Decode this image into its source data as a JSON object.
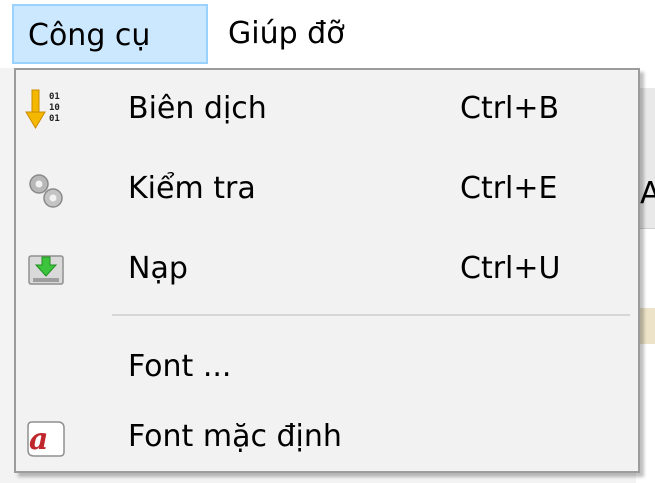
{
  "menubar": {
    "items": [
      {
        "label": "Công cụ",
        "active": true
      },
      {
        "label": "Giúp đỡ",
        "active": false
      }
    ]
  },
  "menu": {
    "items": [
      {
        "label": "Biên dịch",
        "shortcut": "Ctrl+B",
        "icon": "compile-icon"
      },
      {
        "label": "Kiểm tra",
        "shortcut": "Ctrl+E",
        "icon": "gears-icon"
      },
      {
        "label": "Nạp",
        "shortcut": "Ctrl+U",
        "icon": "upload-icon"
      },
      {
        "label": "Font ...",
        "shortcut": "",
        "icon": ""
      },
      {
        "label": "Font mặc định",
        "shortcut": "",
        "icon": "default-font-icon"
      }
    ]
  },
  "background": {
    "partial_text": "A"
  },
  "colors": {
    "menu_highlight": "#cce8ff",
    "menu_highlight_border": "#99d1ff",
    "menu_bg": "#f2f2f2"
  }
}
